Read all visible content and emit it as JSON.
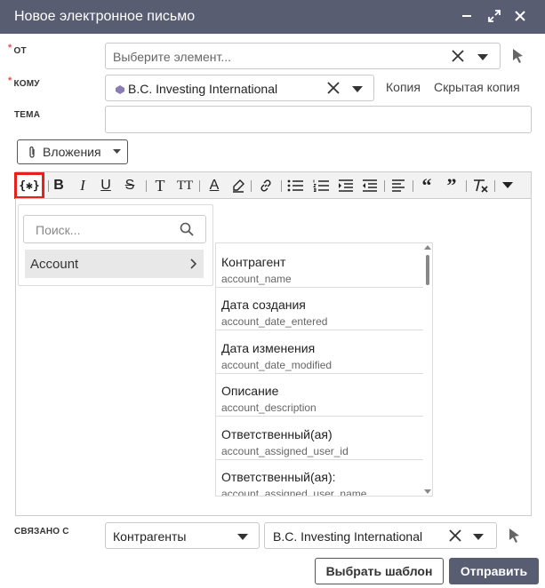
{
  "header": {
    "title": "Новое электронное письмо"
  },
  "form": {
    "from": {
      "label": "ОТ",
      "placeholder": "Выберите элемент..."
    },
    "to": {
      "label": "КОМУ",
      "recipient": "B.C. Investing International",
      "cc_label": "Копия",
      "bcc_label": "Скрытая копия"
    },
    "subject": {
      "label": "ТЕМА",
      "value": ""
    },
    "attachments_label": "Вложения"
  },
  "variables": {
    "search_placeholder": "Поиск...",
    "module": "Account",
    "fields": [
      {
        "title": "Контрагент",
        "key": "account_name"
      },
      {
        "title": "Дата создания",
        "key": "account_date_entered"
      },
      {
        "title": "Дата изменения",
        "key": "account_date_modified"
      },
      {
        "title": "Описание",
        "key": "account_description"
      },
      {
        "title": "Ответственный(ая)",
        "key": "account_assigned_user_id"
      },
      {
        "title": "Ответственный(ая):",
        "key": "account_assigned_user_name"
      }
    ]
  },
  "related": {
    "label": "СВЯЗАНО С",
    "module": "Контрагенты",
    "record": "B.C. Investing International"
  },
  "footer": {
    "choose_template": "Выбрать шаблон",
    "send": "Отправить"
  },
  "colors": {
    "header_bg": "#585d72",
    "send_bg": "#585d72",
    "highlight_border": "#e8201c"
  }
}
